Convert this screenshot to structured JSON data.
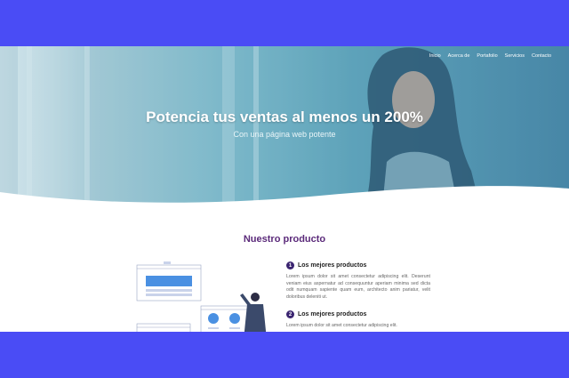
{
  "nav": {
    "items": [
      "Inicio",
      "Acerca de",
      "Portafolio",
      "Servicios",
      "Contacto"
    ]
  },
  "hero": {
    "title": "Potencia tus ventas al menos un 200%",
    "subtitle": "Con una página web potente"
  },
  "product": {
    "heading": "Nuestro producto",
    "features": [
      {
        "number": "1",
        "title": "Los mejores productos",
        "text": "Lorem ipsum dolor sit amet consectetur adipiscing elit. Deserunt veniam eius aspernatur ad consequuntur aperiam minima sed dicta odit numquam sapiente quam eum, architecto anim pariatur, velit doloribus deleniti ut."
      },
      {
        "number": "2",
        "title": "Los mejores productos",
        "text": "Lorem ipsum dolor sit amet consectetur adipiscing elit."
      }
    ]
  },
  "colors": {
    "page_background": "#4a4cf5",
    "heading": "#5b2a7a",
    "badge": "#3a2470",
    "accent": "#4a90e2"
  }
}
